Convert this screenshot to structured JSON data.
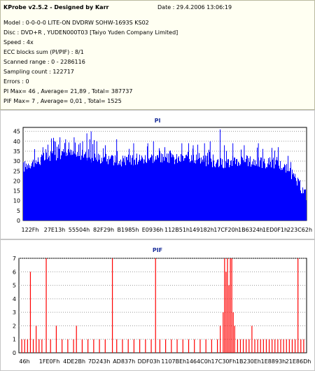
{
  "info": {
    "title": "KProbe v2.5.2 - Designed by Karr",
    "date": "Date : 29.4.2006 13:06:19",
    "lines": [
      "Model : 0-0-0-0 LITE-ON DVDRW SOHW-1693S KS02",
      "Disc : DVD+R , YUDEN000T03 [Taiyo Yuden Company Limited]",
      "Speed : 4x",
      "ECC blocks sum (PI/PIF) : 8/1",
      "Scanned range : 0 - 2286116",
      "Sampling count : 122717",
      "Errors : 0",
      "PI Max= 46 , Average= 21,89 , Total= 387737",
      "PIF Max= 7 , Average= 0,01 , Total= 1525"
    ]
  },
  "chart_data": [
    {
      "type": "bar",
      "title": "PI",
      "color": "#0000ff",
      "ylim": [
        0,
        47
      ],
      "yticks": [
        "0",
        "5",
        "10",
        "15",
        "20",
        "25",
        "30",
        "35",
        "40",
        "45"
      ],
      "xticks": [
        "122Fh",
        "27E13h",
        "55504h",
        "82F29h",
        "B1985h",
        "E0936h",
        "112B51h",
        "149182h",
        "17CF20h",
        "1B6324h",
        "1ED0F1h",
        "223C62h"
      ],
      "grid": "horizontal dotted",
      "profile": [
        [
          0,
          28
        ],
        [
          0.02,
          30
        ],
        [
          0.05,
          31
        ],
        [
          0.1,
          34
        ],
        [
          0.15,
          35
        ],
        [
          0.2,
          34
        ],
        [
          0.25,
          33
        ],
        [
          0.3,
          32
        ],
        [
          0.35,
          31
        ],
        [
          0.4,
          32
        ],
        [
          0.45,
          33
        ],
        [
          0.5,
          32
        ],
        [
          0.55,
          32
        ],
        [
          0.6,
          33
        ],
        [
          0.65,
          31
        ],
        [
          0.7,
          30
        ],
        [
          0.75,
          31
        ],
        [
          0.8,
          31
        ],
        [
          0.85,
          30
        ],
        [
          0.88,
          30
        ],
        [
          0.91,
          29
        ],
        [
          0.93,
          27
        ],
        [
          0.95,
          24
        ],
        [
          0.97,
          20
        ],
        [
          0.99,
          16
        ],
        [
          1,
          14
        ]
      ],
      "peaks": [
        [
          0.07,
          37
        ],
        [
          0.08,
          36
        ],
        [
          0.11,
          40
        ],
        [
          0.13,
          42
        ],
        [
          0.15,
          41
        ],
        [
          0.18,
          42
        ],
        [
          0.21,
          40
        ],
        [
          0.225,
          44
        ],
        [
          0.235,
          41
        ],
        [
          0.24,
          45
        ],
        [
          0.26,
          40
        ],
        [
          0.29,
          38
        ],
        [
          0.33,
          41
        ],
        [
          0.39,
          39
        ],
        [
          0.44,
          39
        ],
        [
          0.46,
          40
        ],
        [
          0.5,
          37
        ],
        [
          0.56,
          39
        ],
        [
          0.6,
          38
        ],
        [
          0.64,
          39
        ],
        [
          0.66,
          40
        ],
        [
          0.695,
          46
        ],
        [
          0.71,
          38
        ],
        [
          0.74,
          39
        ],
        [
          0.78,
          38
        ],
        [
          0.83,
          39
        ],
        [
          0.9,
          37
        ]
      ]
    },
    {
      "type": "bar",
      "title": "PIF",
      "color": "#ff0000",
      "ylim": [
        0,
        7
      ],
      "yticks": [
        "0",
        "1",
        "2",
        "3",
        "4",
        "5",
        "6",
        "7"
      ],
      "xticks": [
        "46h",
        "1FE0Fh",
        "4DE2Bh",
        "7D243h",
        "AD837h",
        "DDF03h",
        "1107BEh",
        "1464C0h",
        "17C30Fh",
        "1B230Eh",
        "1E8893h",
        "21E86Dh"
      ],
      "grid": "horizontal dotted",
      "spikes": [
        [
          0.01,
          1
        ],
        [
          0.02,
          1
        ],
        [
          0.03,
          1
        ],
        [
          0.04,
          6
        ],
        [
          0.05,
          1
        ],
        [
          0.06,
          2
        ],
        [
          0.07,
          1
        ],
        [
          0.08,
          1
        ],
        [
          0.095,
          7
        ],
        [
          0.11,
          1
        ],
        [
          0.13,
          2
        ],
        [
          0.15,
          1
        ],
        [
          0.17,
          1
        ],
        [
          0.19,
          1
        ],
        [
          0.2,
          2
        ],
        [
          0.22,
          1
        ],
        [
          0.24,
          1
        ],
        [
          0.26,
          1
        ],
        [
          0.28,
          1
        ],
        [
          0.3,
          1
        ],
        [
          0.325,
          7
        ],
        [
          0.34,
          1
        ],
        [
          0.36,
          1
        ],
        [
          0.38,
          1
        ],
        [
          0.4,
          1
        ],
        [
          0.42,
          1
        ],
        [
          0.44,
          1
        ],
        [
          0.46,
          1
        ],
        [
          0.475,
          7
        ],
        [
          0.49,
          1
        ],
        [
          0.51,
          1
        ],
        [
          0.53,
          1
        ],
        [
          0.55,
          1
        ],
        [
          0.57,
          1
        ],
        [
          0.59,
          1
        ],
        [
          0.61,
          1
        ],
        [
          0.63,
          1
        ],
        [
          0.65,
          1
        ],
        [
          0.67,
          1
        ],
        [
          0.69,
          1
        ],
        [
          0.7,
          2
        ],
        [
          0.71,
          3
        ],
        [
          0.715,
          7
        ],
        [
          0.72,
          6
        ],
        [
          0.725,
          7
        ],
        [
          0.73,
          5
        ],
        [
          0.735,
          7
        ],
        [
          0.74,
          7
        ],
        [
          0.745,
          3
        ],
        [
          0.75,
          2
        ],
        [
          0.76,
          1
        ],
        [
          0.77,
          1
        ],
        [
          0.78,
          1
        ],
        [
          0.79,
          1
        ],
        [
          0.8,
          1
        ],
        [
          0.81,
          2
        ],
        [
          0.82,
          1
        ],
        [
          0.83,
          1
        ],
        [
          0.84,
          1
        ],
        [
          0.85,
          1
        ],
        [
          0.86,
          1
        ],
        [
          0.87,
          1
        ],
        [
          0.88,
          1
        ],
        [
          0.89,
          1
        ],
        [
          0.9,
          1
        ],
        [
          0.91,
          1
        ],
        [
          0.92,
          1
        ],
        [
          0.93,
          1
        ],
        [
          0.94,
          1
        ],
        [
          0.95,
          1
        ],
        [
          0.96,
          1
        ],
        [
          0.97,
          7
        ],
        [
          0.98,
          1
        ],
        [
          0.99,
          1
        ]
      ]
    }
  ]
}
